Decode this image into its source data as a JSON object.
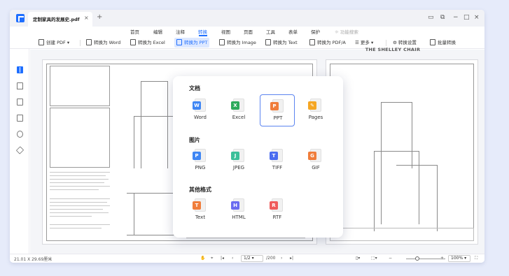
{
  "titlebar": {
    "tab_title": "定制家具的发展史.pdf",
    "close_glyph": "×",
    "add_glyph": "+"
  },
  "menu": {
    "items": [
      "首页",
      "编辑",
      "注释",
      "转换",
      "视图",
      "页面",
      "工具",
      "表单",
      "保护"
    ],
    "active": "转换",
    "search_label": "功能搜索"
  },
  "toolbar": {
    "create_pdf": "创建 PDF",
    "to_word": "转换为 Word",
    "to_excel": "转换为 Excel",
    "to_ppt": "转换为 PPT",
    "to_image": "转换为 Image",
    "to_text": "转换为 Text",
    "to_pdfa": "转换为 PDF/A",
    "more": "更多",
    "convert_settings": "转换设置",
    "batch_convert": "批量转换"
  },
  "document": {
    "right_page_title": "THE SHELLEY CHAIR"
  },
  "popup": {
    "sections": [
      {
        "title": "文档",
        "items": [
          {
            "label": "Word",
            "badge": "W",
            "color": "#3f86f4"
          },
          {
            "label": "Excel",
            "badge": "X",
            "color": "#2eaa5c"
          },
          {
            "label": "PPT",
            "badge": "P",
            "color": "#f07d3b"
          },
          {
            "label": "Pages",
            "badge": "✎",
            "color": "#f5a623"
          }
        ]
      },
      {
        "title": "图片",
        "items": [
          {
            "label": "PNG",
            "badge": "P",
            "color": "#3f86f4"
          },
          {
            "label": "JPEG",
            "badge": "J",
            "color": "#3cbf9a"
          },
          {
            "label": "TIFF",
            "badge": "T",
            "color": "#4a6cf0"
          },
          {
            "label": "GIF",
            "badge": "G",
            "color": "#f07d3b"
          }
        ]
      },
      {
        "title": "其他格式",
        "items": [
          {
            "label": "Text",
            "badge": "T",
            "color": "#f07d3b"
          },
          {
            "label": "HTML",
            "badge": "H",
            "color": "#6a6cf0"
          },
          {
            "label": "RTF",
            "badge": "R",
            "color": "#ef5b5b"
          }
        ]
      }
    ],
    "selected": "PPT"
  },
  "statusbar": {
    "page_size": "21.01 X 29.69厘米",
    "current_page": "1/2",
    "total_pages": "/200",
    "zoom": "100%"
  }
}
